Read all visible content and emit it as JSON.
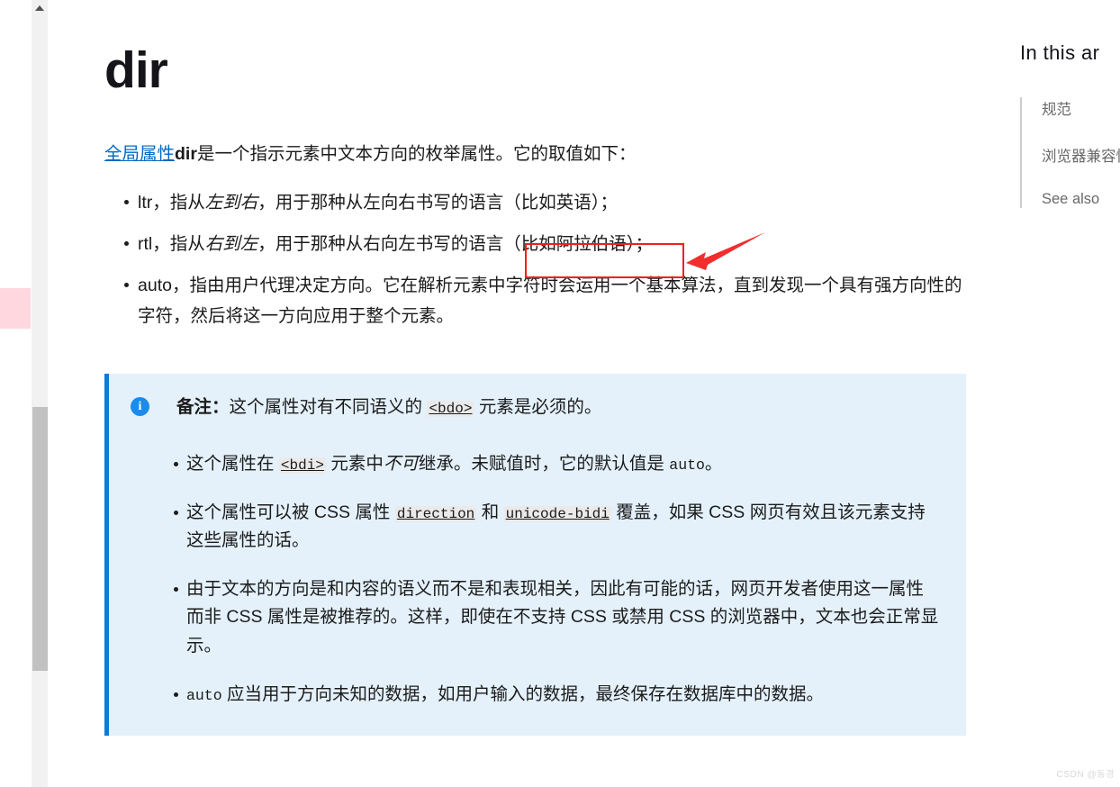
{
  "page": {
    "title": "dir",
    "intro": {
      "link_text": "全局属性",
      "bold_text": "dir",
      "rest": "是一个指示元素中文本方向的枚举属性。它的取值如下："
    }
  },
  "values_list": [
    {
      "code": "ltr",
      "part1": "，指从",
      "emphasis": "左到右",
      "part2": "，用于那种从左向右书写的语言（比如英语）；"
    },
    {
      "code": "rtl",
      "part1": "，指从",
      "emphasis": "右到左",
      "part2": "，用于那种从右向左书写的语言",
      "highlighted": "（比如阿拉伯语）；"
    },
    {
      "code": "auto",
      "part1": "，指由用户代理决定方向。它在解析元素中字符时会运用一个基本算法，直到发现一个具有强方向性的字符，然后将这一方向应用于整个元素。"
    }
  ],
  "note": {
    "icon": "info-icon",
    "label": "备注：",
    "head_before": "这个属性对有不同语义的 ",
    "head_code": "<bdo>",
    "head_after": " 元素是必须的。",
    "items": [
      {
        "segments": [
          {
            "type": "text",
            "value": "这个属性在 "
          },
          {
            "type": "code",
            "value": "<bdi>"
          },
          {
            "type": "text",
            "value": " 元素中"
          },
          {
            "type": "em",
            "value": "不可"
          },
          {
            "type": "text",
            "value": "继承。未赋值时，它的默认值是 "
          },
          {
            "type": "plain-code",
            "value": "auto"
          },
          {
            "type": "text",
            "value": "。"
          }
        ]
      },
      {
        "segments": [
          {
            "type": "text",
            "value": "这个属性可以被 CSS 属性 "
          },
          {
            "type": "code",
            "value": "direction"
          },
          {
            "type": "text",
            "value": " 和 "
          },
          {
            "type": "code",
            "value": "unicode-bidi"
          },
          {
            "type": "text",
            "value": " 覆盖，如果 CSS 网页有效且该元素支持这些属性的话。"
          }
        ]
      },
      {
        "segments": [
          {
            "type": "text",
            "value": "由于文本的方向是和内容的语义而不是和表现相关，因此有可能的话，网页开发者使用这一属性而非 CSS 属性是被推荐的。这样，即使在不支持 CSS 或禁用 CSS 的浏览器中，文本也会正常显示。"
          }
        ]
      },
      {
        "segments": [
          {
            "type": "plain-code",
            "value": "auto"
          },
          {
            "type": "text",
            "value": " 应当用于方向未知的数据，如用户输入的数据，最终保存在数据库中的数据。"
          }
        ]
      }
    ]
  },
  "toc": {
    "title": "In this ar",
    "items": [
      {
        "label": "规范"
      },
      {
        "label": "浏览器兼容性"
      },
      {
        "label": "See also"
      }
    ]
  },
  "scrollbar": {
    "up_arrow_icon": "triangle-up-icon",
    "thumb_color": "#c1c1c1",
    "track_color": "#f1f1f1"
  },
  "marker": {
    "color": "#ffd7de"
  },
  "annotation": {
    "box_color": "#ee2020",
    "arrow_color": "#f22d2d",
    "arrow_icon": "left-arrow-icon"
  },
  "watermark": {
    "text": "CSDN @동경"
  },
  "colors": {
    "link": "#0069c2",
    "note_bg": "#e4f1fb",
    "note_border": "#0d7bd4",
    "info_icon": "#1b8ceb",
    "text": "#1b1b1b",
    "toc_text": "#696969"
  }
}
